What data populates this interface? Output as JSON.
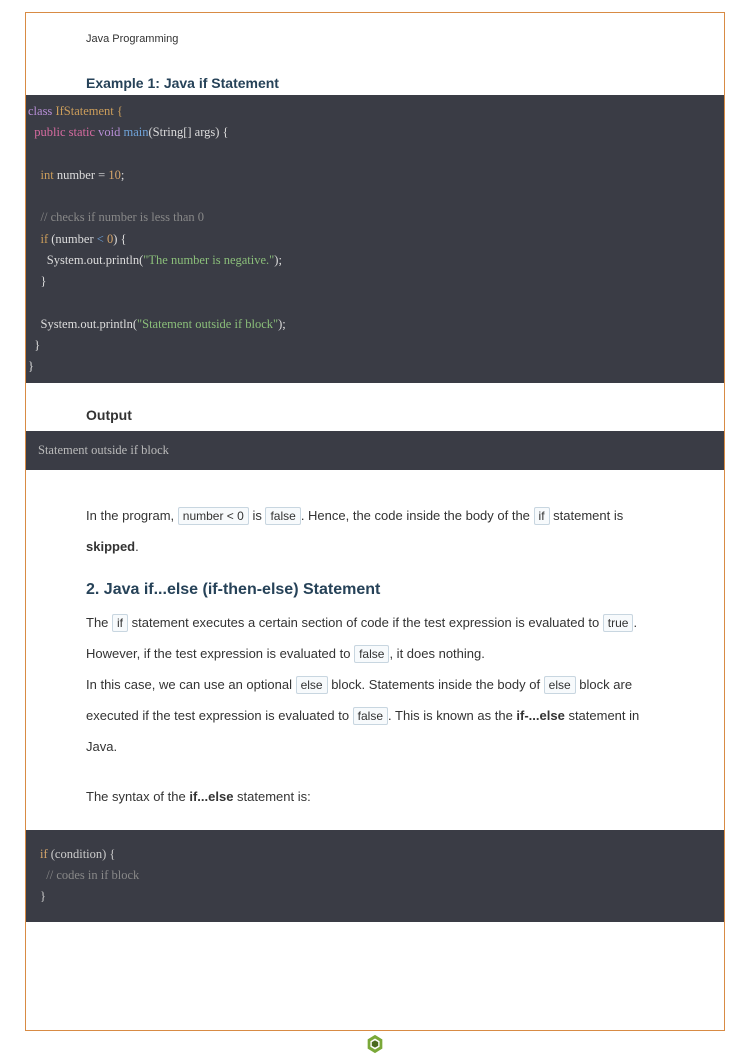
{
  "header": "Java Programming",
  "example": {
    "title": "Example 1: Java if Statement",
    "code": {
      "class_kw": "class",
      "class_name": " IfStatement {",
      "mods": "public static ",
      "void_kw": "void",
      "main_fn": " main",
      "main_args": "(String[] args) {",
      "int_kw": "int",
      "var_decl": " number = ",
      "num_10": "10",
      "semi": ";",
      "comment1": "// checks if number is less than 0",
      "if_kw": "if",
      "if_cond_open": " (number ",
      "lt": "<",
      "zero": " 0",
      "if_cond_close": ") {",
      "println1_pre": "      System.out.println(",
      "str_neg": "\"The number is negative.\"",
      "println1_post": ");",
      "close_brace": "    }",
      "println2_pre": "    System.out.println(",
      "str_out": "\"Statement outside if block\"",
      "println2_post": ");",
      "close_main": "  }",
      "close_class": "}"
    }
  },
  "output": {
    "title": "Output",
    "text": "Statement outside if block"
  },
  "para1": {
    "t1": "In the program, ",
    "c1": "number < 0",
    "t2": " is ",
    "c2": "false",
    "t3": ". Hence, the code inside the body of the ",
    "c3": "if",
    "t4": " statement is ",
    "b1": "skipped",
    "t5": "."
  },
  "section2": {
    "title": "2. Java if...else (if-then-else) Statement",
    "p1_t1": "The ",
    "p1_c1": "if",
    "p1_t2": " statement executes a certain section of code if the test expression is evaluated to ",
    "p1_c2": "true",
    "p1_t3": ". However, if the test expression is evaluated to ",
    "p1_c3": "false",
    "p1_t4": ", it does nothing.",
    "p2_t1": "In this case, we can use an optional ",
    "p2_c1": "else",
    "p2_t2": " block. Statements inside the body of ",
    "p2_c2": "else",
    "p2_t3": " block are executed if the test expression is evaluated to ",
    "p2_c3": "false",
    "p2_t4": ". This is known as the ",
    "p2_b1": "if-...else",
    "p2_t5": " statement in Java.",
    "p3_t1": "The syntax of the ",
    "p3_b1": "if...else",
    "p3_t2": " statement is:"
  },
  "syntax": {
    "if_kw": "if",
    "cond": " (condition) {",
    "comment": "  // codes in if block",
    "close": "}"
  }
}
